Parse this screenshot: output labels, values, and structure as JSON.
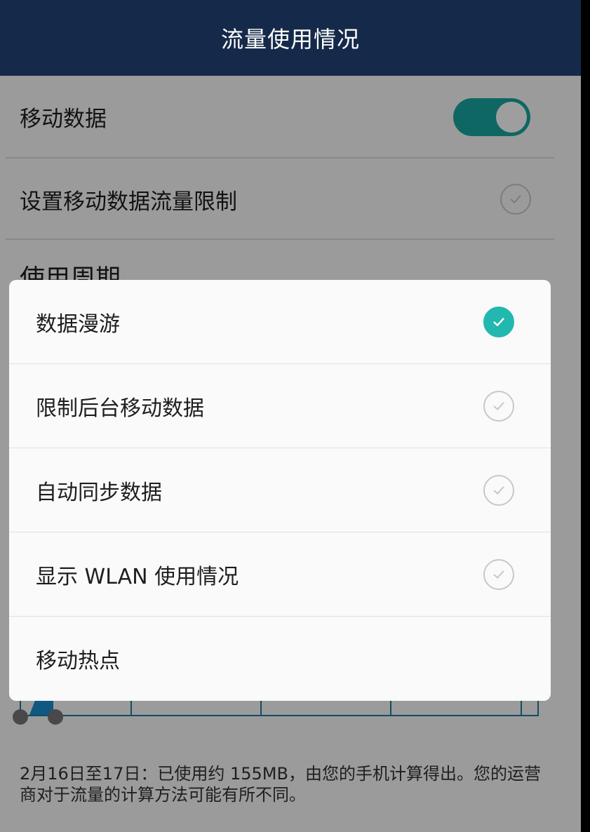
{
  "header": {
    "title": "流量使用情况"
  },
  "settings": {
    "mobile_data": {
      "label": "移动数据",
      "enabled": true
    },
    "data_limit": {
      "label": "设置移动数据流量限制",
      "checked": false
    },
    "cycle_title": "使用周期"
  },
  "footer": {
    "note": "2月16日至17日：已使用约 155MB，由您的手机计算得出。您的运营商对于流量的计算方法可能有所不同。"
  },
  "menu": {
    "items": [
      {
        "label": "数据漫游",
        "checked": true,
        "has_checkbox": true
      },
      {
        "label": "限制后台移动数据",
        "checked": false,
        "has_checkbox": true
      },
      {
        "label": "自动同步数据",
        "checked": false,
        "has_checkbox": true
      },
      {
        "label": "显示 WLAN 使用情况",
        "checked": false,
        "has_checkbox": true
      },
      {
        "label": "移动热点",
        "has_checkbox": false
      }
    ]
  },
  "colors": {
    "header_bg": "#152a4a",
    "accent": "#22b8b0",
    "toggle_on": "#18a79e",
    "chart_line": "#1b7fa0",
    "chart_fill": "#1a8fd0"
  },
  "icons": {
    "checkmark": "check-icon",
    "toggle_knob": "toggle-knob-icon"
  }
}
